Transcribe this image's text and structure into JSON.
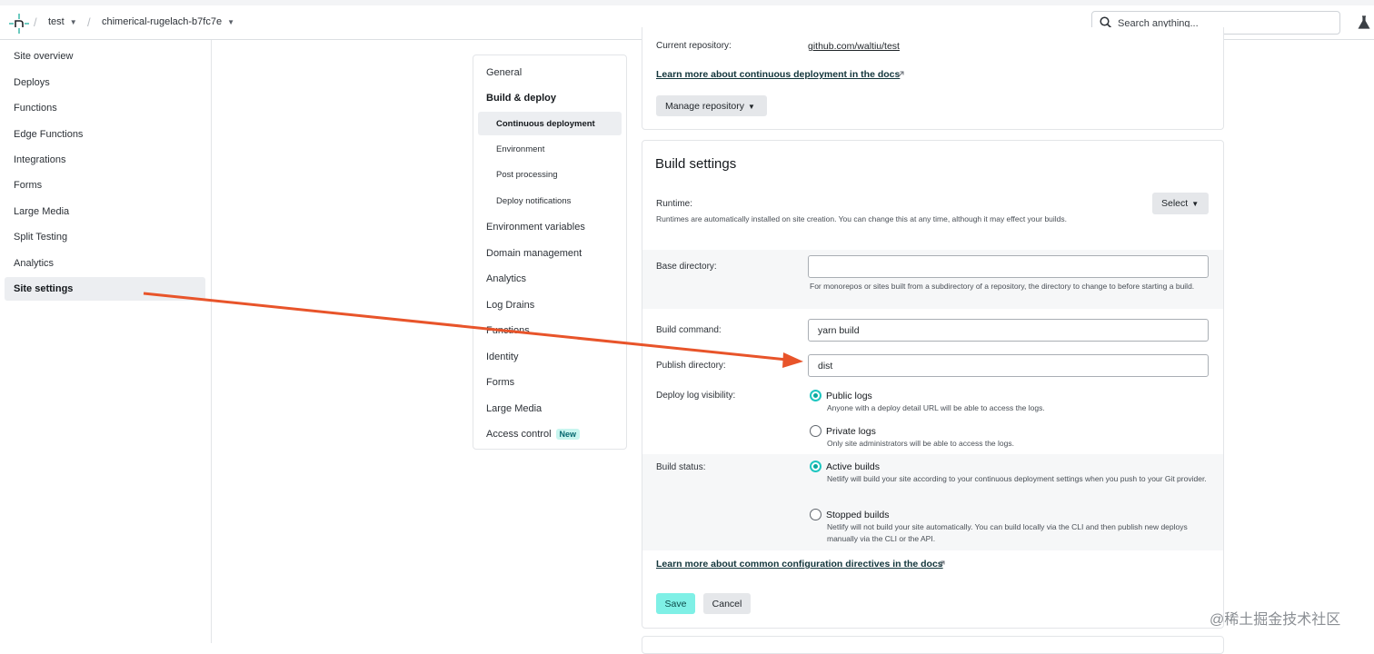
{
  "header": {
    "crumbs": [
      {
        "label": "test"
      },
      {
        "label": "chimerical-rugelach-b7fc7e"
      }
    ],
    "search_placeholder": "Search anything..."
  },
  "leftnav": {
    "items": [
      {
        "label": "Site overview"
      },
      {
        "label": "Deploys"
      },
      {
        "label": "Functions"
      },
      {
        "label": "Edge Functions"
      },
      {
        "label": "Integrations"
      },
      {
        "label": "Forms"
      },
      {
        "label": "Large Media"
      },
      {
        "label": "Split Testing"
      },
      {
        "label": "Analytics"
      },
      {
        "label": "Site settings"
      }
    ],
    "active": "Site settings"
  },
  "subnav": {
    "general": "General",
    "build_deploy": "Build & deploy",
    "sub": [
      "Continuous deployment",
      "Environment",
      "Post processing",
      "Deploy notifications"
    ],
    "items": [
      "Environment variables",
      "Domain management",
      "Analytics",
      "Log Drains",
      "Functions",
      "Identity",
      "Forms",
      "Large Media"
    ],
    "access_control": "Access control",
    "new_badge": "New"
  },
  "repo_card": {
    "label": "Current repository:",
    "value": "github.com/waltiu/test",
    "docs_link": "Learn more about continuous deployment in the docs",
    "manage_button": "Manage repository"
  },
  "build_settings": {
    "title": "Build settings",
    "runtime_label": "Runtime:",
    "runtime_help": "Runtimes are automatically installed on site creation. You can change this at any time, although it may effect your builds.",
    "runtime_button": "Select",
    "base_dir_label": "Base directory:",
    "base_dir_value": "",
    "base_dir_help": "For monorepos or sites built from a subdirectory of a repository, the directory to change to before starting a build.",
    "build_cmd_label": "Build command:",
    "build_cmd_value": "yarn build",
    "publish_dir_label": "Publish directory:",
    "publish_dir_value": "dist",
    "log_visibility_label": "Deploy log visibility:",
    "public_logs_title": "Public logs",
    "public_logs_help": "Anyone with a deploy detail URL will be able to access the logs.",
    "private_logs_title": "Private logs",
    "private_logs_help": "Only site administrators will be able to access the logs.",
    "build_status_label": "Build status:",
    "active_builds_title": "Active builds",
    "active_builds_help": "Netlify will build your site according to your continuous deployment settings when you push to your Git provider.",
    "stopped_builds_title": "Stopped builds",
    "stopped_builds_help": "Netlify will not build your site automatically. You can build locally via the CLI and then publish new deploys manually via the CLI or the API.",
    "docs_link": "Learn more about common configuration directives in the docs",
    "save_label": "Save",
    "cancel_label": "Cancel"
  },
  "colors": {
    "accent": "#1ec6c0",
    "save_bg": "#7ff0e6",
    "annotation_arrow": "#e8542a"
  },
  "watermark": "@稀土掘金技术社区"
}
